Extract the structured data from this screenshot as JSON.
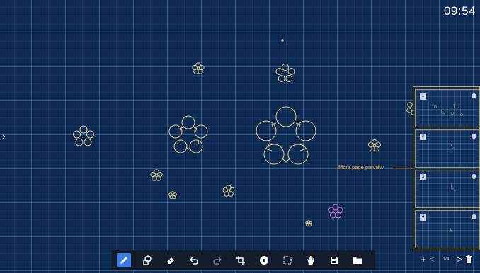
{
  "clock": {
    "time": "09:54"
  },
  "callout": {
    "label": "More page preview"
  },
  "page_preview": {
    "pages": [
      {
        "number": "1"
      },
      {
        "number": "2"
      },
      {
        "number": "3"
      },
      {
        "number": "4"
      }
    ]
  },
  "page_nav": {
    "add": "+",
    "prev": "<",
    "page_count": "1/4",
    "next": ">"
  },
  "toolbar": {
    "tools": [
      {
        "name": "pen",
        "icon": "pen-icon",
        "active": true
      },
      {
        "name": "shapes",
        "icon": "shapes-icon",
        "active": false
      },
      {
        "name": "eraser",
        "icon": "eraser-icon",
        "active": false
      },
      {
        "name": "undo",
        "icon": "undo-icon",
        "active": false
      },
      {
        "name": "redo",
        "icon": "redo-icon",
        "active": false
      },
      {
        "name": "crop",
        "icon": "crop-icon",
        "active": false
      },
      {
        "name": "background",
        "icon": "disc-icon",
        "active": false
      },
      {
        "name": "select",
        "icon": "select-box-icon",
        "active": false
      },
      {
        "name": "pan",
        "icon": "hand-icon",
        "active": false
      },
      {
        "name": "save",
        "icon": "save-icon",
        "active": false
      },
      {
        "name": "open",
        "icon": "folder-icon",
        "active": false
      }
    ]
  },
  "colors": {
    "board_bg": "#0f2a52",
    "shape_stroke": "#d8cf8a",
    "pink_stroke": "#d070d0",
    "callout": "#f0a830",
    "active_tool": "#3d7be0",
    "toolbar_bg": "#141c2c"
  },
  "icons": {
    "expand": "chevron-right-icon",
    "delete_page": "trash-icon"
  }
}
